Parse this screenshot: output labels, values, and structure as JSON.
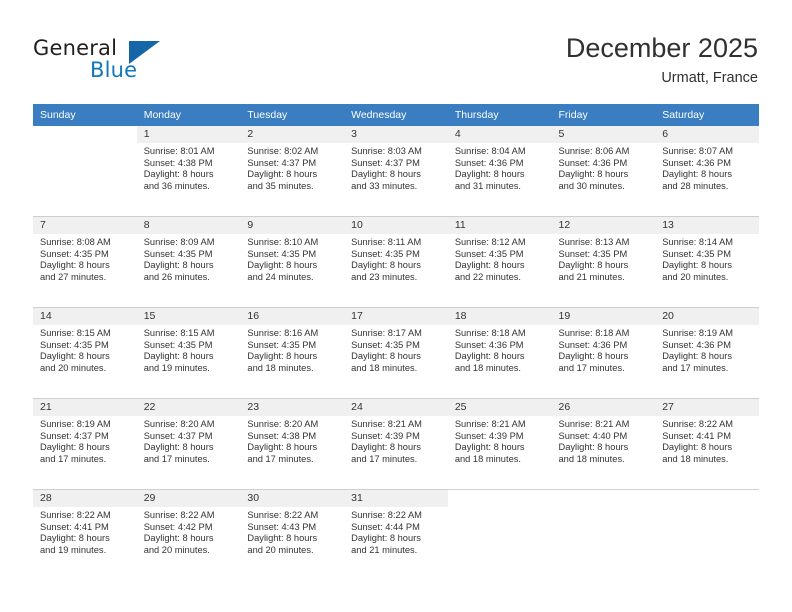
{
  "brand": {
    "line1": "General",
    "line2": "Blue",
    "logo_icon": "blue-triangle-logo"
  },
  "header": {
    "title": "December 2025",
    "subtitle": "Urmatt, France"
  },
  "colors": {
    "header_blue": "#3a7dc0",
    "brand_blue": "#1277bc",
    "row_shade": "#f0f0f0",
    "text": "#333333"
  },
  "weekday_headers": [
    "Sunday",
    "Monday",
    "Tuesday",
    "Wednesday",
    "Thursday",
    "Friday",
    "Saturday"
  ],
  "weeks": [
    [
      {
        "day": "",
        "lines": []
      },
      {
        "day": "1",
        "lines": [
          "Sunrise: 8:01 AM",
          "Sunset: 4:38 PM",
          "Daylight: 8 hours",
          "and 36 minutes."
        ]
      },
      {
        "day": "2",
        "lines": [
          "Sunrise: 8:02 AM",
          "Sunset: 4:37 PM",
          "Daylight: 8 hours",
          "and 35 minutes."
        ]
      },
      {
        "day": "3",
        "lines": [
          "Sunrise: 8:03 AM",
          "Sunset: 4:37 PM",
          "Daylight: 8 hours",
          "and 33 minutes."
        ]
      },
      {
        "day": "4",
        "lines": [
          "Sunrise: 8:04 AM",
          "Sunset: 4:36 PM",
          "Daylight: 8 hours",
          "and 31 minutes."
        ]
      },
      {
        "day": "5",
        "lines": [
          "Sunrise: 8:06 AM",
          "Sunset: 4:36 PM",
          "Daylight: 8 hours",
          "and 30 minutes."
        ]
      },
      {
        "day": "6",
        "lines": [
          "Sunrise: 8:07 AM",
          "Sunset: 4:36 PM",
          "Daylight: 8 hours",
          "and 28 minutes."
        ]
      }
    ],
    [
      {
        "day": "7",
        "lines": [
          "Sunrise: 8:08 AM",
          "Sunset: 4:35 PM",
          "Daylight: 8 hours",
          "and 27 minutes."
        ]
      },
      {
        "day": "8",
        "lines": [
          "Sunrise: 8:09 AM",
          "Sunset: 4:35 PM",
          "Daylight: 8 hours",
          "and 26 minutes."
        ]
      },
      {
        "day": "9",
        "lines": [
          "Sunrise: 8:10 AM",
          "Sunset: 4:35 PM",
          "Daylight: 8 hours",
          "and 24 minutes."
        ]
      },
      {
        "day": "10",
        "lines": [
          "Sunrise: 8:11 AM",
          "Sunset: 4:35 PM",
          "Daylight: 8 hours",
          "and 23 minutes."
        ]
      },
      {
        "day": "11",
        "lines": [
          "Sunrise: 8:12 AM",
          "Sunset: 4:35 PM",
          "Daylight: 8 hours",
          "and 22 minutes."
        ]
      },
      {
        "day": "12",
        "lines": [
          "Sunrise: 8:13 AM",
          "Sunset: 4:35 PM",
          "Daylight: 8 hours",
          "and 21 minutes."
        ]
      },
      {
        "day": "13",
        "lines": [
          "Sunrise: 8:14 AM",
          "Sunset: 4:35 PM",
          "Daylight: 8 hours",
          "and 20 minutes."
        ]
      }
    ],
    [
      {
        "day": "14",
        "lines": [
          "Sunrise: 8:15 AM",
          "Sunset: 4:35 PM",
          "Daylight: 8 hours",
          "and 20 minutes."
        ]
      },
      {
        "day": "15",
        "lines": [
          "Sunrise: 8:15 AM",
          "Sunset: 4:35 PM",
          "Daylight: 8 hours",
          "and 19 minutes."
        ]
      },
      {
        "day": "16",
        "lines": [
          "Sunrise: 8:16 AM",
          "Sunset: 4:35 PM",
          "Daylight: 8 hours",
          "and 18 minutes."
        ]
      },
      {
        "day": "17",
        "lines": [
          "Sunrise: 8:17 AM",
          "Sunset: 4:35 PM",
          "Daylight: 8 hours",
          "and 18 minutes."
        ]
      },
      {
        "day": "18",
        "lines": [
          "Sunrise: 8:18 AM",
          "Sunset: 4:36 PM",
          "Daylight: 8 hours",
          "and 18 minutes."
        ]
      },
      {
        "day": "19",
        "lines": [
          "Sunrise: 8:18 AM",
          "Sunset: 4:36 PM",
          "Daylight: 8 hours",
          "and 17 minutes."
        ]
      },
      {
        "day": "20",
        "lines": [
          "Sunrise: 8:19 AM",
          "Sunset: 4:36 PM",
          "Daylight: 8 hours",
          "and 17 minutes."
        ]
      }
    ],
    [
      {
        "day": "21",
        "lines": [
          "Sunrise: 8:19 AM",
          "Sunset: 4:37 PM",
          "Daylight: 8 hours",
          "and 17 minutes."
        ]
      },
      {
        "day": "22",
        "lines": [
          "Sunrise: 8:20 AM",
          "Sunset: 4:37 PM",
          "Daylight: 8 hours",
          "and 17 minutes."
        ]
      },
      {
        "day": "23",
        "lines": [
          "Sunrise: 8:20 AM",
          "Sunset: 4:38 PM",
          "Daylight: 8 hours",
          "and 17 minutes."
        ]
      },
      {
        "day": "24",
        "lines": [
          "Sunrise: 8:21 AM",
          "Sunset: 4:39 PM",
          "Daylight: 8 hours",
          "and 17 minutes."
        ]
      },
      {
        "day": "25",
        "lines": [
          "Sunrise: 8:21 AM",
          "Sunset: 4:39 PM",
          "Daylight: 8 hours",
          "and 18 minutes."
        ]
      },
      {
        "day": "26",
        "lines": [
          "Sunrise: 8:21 AM",
          "Sunset: 4:40 PM",
          "Daylight: 8 hours",
          "and 18 minutes."
        ]
      },
      {
        "day": "27",
        "lines": [
          "Sunrise: 8:22 AM",
          "Sunset: 4:41 PM",
          "Daylight: 8 hours",
          "and 18 minutes."
        ]
      }
    ],
    [
      {
        "day": "28",
        "lines": [
          "Sunrise: 8:22 AM",
          "Sunset: 4:41 PM",
          "Daylight: 8 hours",
          "and 19 minutes."
        ]
      },
      {
        "day": "29",
        "lines": [
          "Sunrise: 8:22 AM",
          "Sunset: 4:42 PM",
          "Daylight: 8 hours",
          "and 20 minutes."
        ]
      },
      {
        "day": "30",
        "lines": [
          "Sunrise: 8:22 AM",
          "Sunset: 4:43 PM",
          "Daylight: 8 hours",
          "and 20 minutes."
        ]
      },
      {
        "day": "31",
        "lines": [
          "Sunrise: 8:22 AM",
          "Sunset: 4:44 PM",
          "Daylight: 8 hours",
          "and 21 minutes."
        ]
      },
      {
        "day": "",
        "lines": []
      },
      {
        "day": "",
        "lines": []
      },
      {
        "day": "",
        "lines": []
      }
    ]
  ]
}
